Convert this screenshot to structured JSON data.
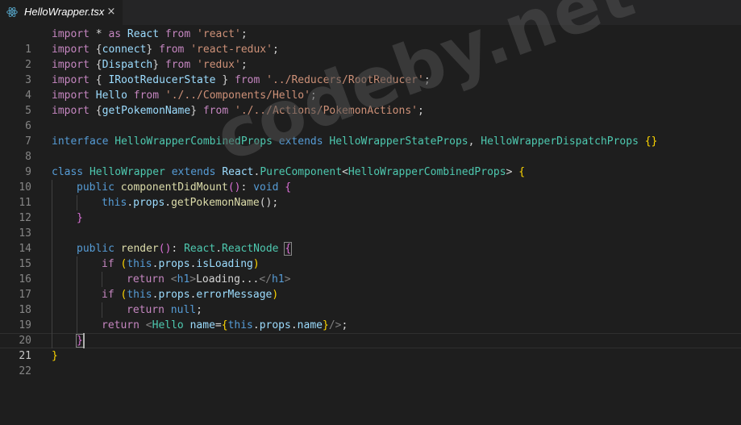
{
  "tab": {
    "icon": "react-icon",
    "title": "HelloWrapper.tsx",
    "close_icon": "close-icon",
    "close_glyph": "×"
  },
  "line_numbers": [
    "1",
    "2",
    "3",
    "4",
    "5",
    "6",
    "7",
    "8",
    "9",
    "10",
    "11",
    "12",
    "13",
    "14",
    "15",
    "16",
    "17",
    "18",
    "19",
    "20",
    "21",
    "22"
  ],
  "code": {
    "l1": {
      "import": "import",
      "star": " * ",
      "as": "as",
      "name": " React ",
      "from": "from",
      "str": " 'react'",
      "semi": ";"
    },
    "l2": {
      "import": "import",
      "open": " {",
      "name": "connect",
      "close": "} ",
      "from": "from",
      "str": " 'react-redux'",
      "semi": ";"
    },
    "l3": {
      "import": "import",
      "open": " {",
      "name": "Dispatch",
      "close": "} ",
      "from": "from",
      "str": " 'redux'",
      "semi": ";"
    },
    "l4": {
      "import": "import",
      "open": " { ",
      "name": "IRootReducerState",
      "close": " } ",
      "from": "from",
      "str": " '../Reducers/RootReducer'",
      "semi": ";"
    },
    "l5": {
      "import": "import",
      "name": " Hello ",
      "from": "from",
      "str": " './../Components/Hello'",
      "semi": ";"
    },
    "l6": {
      "import": "import",
      "open": " {",
      "name": "getPokemonName",
      "close": "} ",
      "from": "from",
      "str": " './../Actions/PokemonActions'",
      "semi": ";"
    },
    "l8": {
      "interface": "interface",
      "name": " HelloWrapperCombinedProps ",
      "extends": "extends",
      "t1": " HelloWrapperStateProps",
      "comma": ", ",
      "t2": "HelloWrapperDispatchProps",
      "braces": " {}"
    },
    "l10": {
      "class": "class",
      "name": " HelloWrapper ",
      "extends": "extends",
      "react": " React",
      "dot": ".",
      "pc": "PureComponent",
      "lt": "<",
      "props": "HelloWrapperCombinedProps",
      "gt": "> ",
      "open": "{"
    },
    "l11": {
      "public": "public",
      "fn": " componentDidMount",
      "parens": "()",
      "colon": ": ",
      "void": "void",
      "open": " {"
    },
    "l12": {
      "this": "this",
      "dot1": ".",
      "props": "props",
      "dot2": ".",
      "fn": "getPokemonName",
      "parens": "()",
      "semi": ";"
    },
    "l13": {
      "close": "}"
    },
    "l15": {
      "public": "public",
      "fn": " render",
      "parens": "()",
      "colon": ": ",
      "react": "React",
      "dot": ".",
      "type": "ReactNode",
      "open": "{"
    },
    "l16": {
      "if": "if",
      "open": " (",
      "this": "this",
      "dot1": ".",
      "props": "props",
      "dot2": ".",
      "prop": "isLoading",
      "close": ")"
    },
    "l17": {
      "return": "return",
      "tag_open": " <",
      "tag": "h1",
      "tag_close": ">",
      "text": "Loading...",
      "end_open": "</",
      "end_tag": "h1",
      "end_close": ">"
    },
    "l18": {
      "if": "if",
      "open": " (",
      "this": "this",
      "dot1": ".",
      "props": "props",
      "dot2": ".",
      "prop": "errorMessage",
      "close": ")"
    },
    "l19": {
      "return": "return",
      "null": " null",
      "semi": ";"
    },
    "l20": {
      "return": "return",
      "lt": " <",
      "comp": "Hello",
      "attr": " name",
      "eq": "=",
      "lb": "{",
      "this": "this",
      "dot1": ".",
      "props": "props",
      "dot2": ".",
      "prop": "name",
      "rb": "}",
      "end": "/>",
      "semi": ";"
    },
    "l21": {
      "close": "}"
    },
    "l22": {
      "close": "}"
    }
  },
  "watermark": "codeby.net",
  "colors": {
    "background": "#1e1e1e",
    "keyword": "#c586c0",
    "storage": "#569cd6",
    "string": "#ce9178",
    "variable": "#9cdcfe",
    "type": "#4ec9b0",
    "function": "#dcdcaa"
  }
}
